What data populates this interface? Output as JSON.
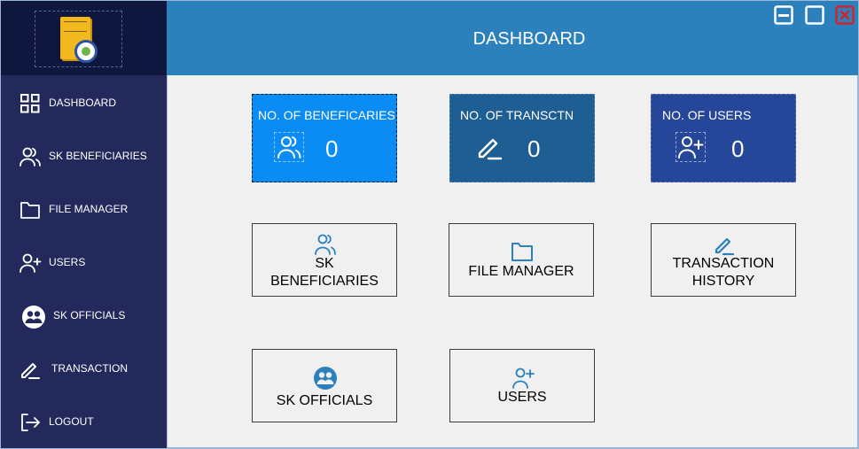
{
  "header": {
    "title": "DASHBOARD"
  },
  "window_controls": [
    "minimize-icon",
    "maximize-icon",
    "close-icon"
  ],
  "sidebar": {
    "logo": "sk-logo",
    "items": [
      {
        "label": "DASHBOARD",
        "icon": "grid-icon"
      },
      {
        "label": "SK BENEFICIARIES",
        "icon": "users-icon"
      },
      {
        "label": "FILE MANAGER",
        "icon": "folder-icon"
      },
      {
        "label": "USERS",
        "icon": "user-plus-icon"
      },
      {
        "label": "SK OFFICIALS",
        "icon": "officials-icon"
      },
      {
        "label": "TRANSACTION",
        "icon": "pencil-icon"
      },
      {
        "label": "LOGOUT",
        "icon": "logout-icon"
      }
    ]
  },
  "stats": [
    {
      "title": "NO. OF BENEFICARIES",
      "value": "0",
      "icon": "users-icon",
      "color": "#0b8cf5"
    },
    {
      "title": "NO. OF TRANSCTN",
      "value": "0",
      "icon": "pencil-icon",
      "color": "#1f5e92"
    },
    {
      "title": "NO. OF USERS",
      "value": "0",
      "icon": "user-plus-icon",
      "color": "#264699"
    }
  ],
  "tiles": [
    {
      "label": "SK\nBENEFICIARIES",
      "icon": "users-icon"
    },
    {
      "label": "FILE MANAGER",
      "icon": "folder-icon"
    },
    {
      "label": "TRANSACTION\nHISTORY",
      "icon": "pencil-icon"
    },
    {
      "label": "SK OFFICIALS",
      "icon": "officials-icon"
    },
    {
      "label": "USERS",
      "icon": "user-plus-icon"
    }
  ],
  "colors": {
    "sidebar": "#232a5b",
    "logo_bg": "#10173f",
    "header": "#2c81bd",
    "icon_accent": "#2c81bd",
    "close": "#d0242b"
  }
}
